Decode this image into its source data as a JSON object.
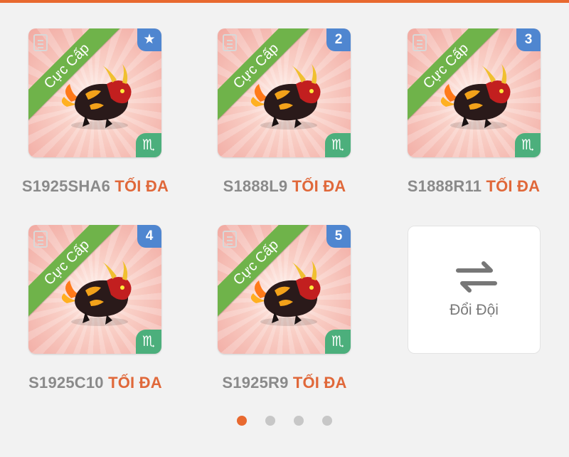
{
  "ribbon_text": "Cực Cấp",
  "zodiac_symbol": "♏",
  "max_label": "TỐI ĐA",
  "slots": [
    {
      "code": "S1925SHA6",
      "badge": "★"
    },
    {
      "code": "S1888L9",
      "badge": "2"
    },
    {
      "code": "S1888R11",
      "badge": "3"
    },
    {
      "code": "S1925C10",
      "badge": "4"
    },
    {
      "code": "S1925R9",
      "badge": "5"
    }
  ],
  "swap_button": {
    "label": "Đổi Đội"
  },
  "pagination": {
    "pages": 4,
    "active": 1
  },
  "colors": {
    "accent": "#e8692f",
    "ribbon": "#6fb34a",
    "badge": "#4f86d0",
    "zodiac": "#4caf7c",
    "label_gray": "#8a8a8a"
  }
}
